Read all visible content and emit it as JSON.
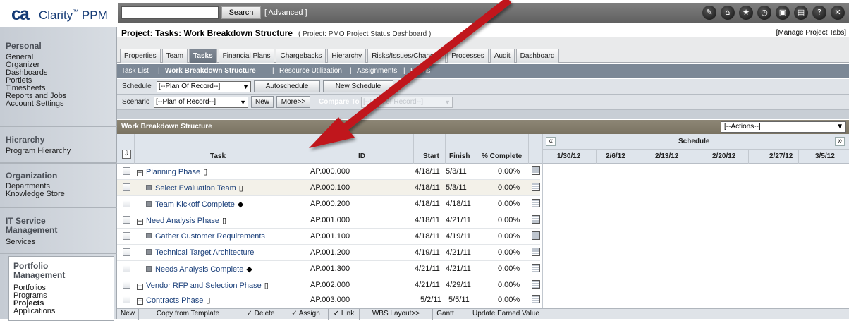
{
  "app": {
    "logo_mark": "ca",
    "product": "Clarity",
    "tm": "™",
    "product_suffix": "PPM"
  },
  "search": {
    "value": "",
    "button": "Search",
    "advanced": "[ Advanced ]"
  },
  "toolbar_icons": [
    "wrench-icon",
    "home-icon",
    "bookmark-icon",
    "clock-icon",
    "window-icon",
    "print-icon",
    "help-icon",
    "close-icon"
  ],
  "sidebar": {
    "personal": {
      "heading": "Personal",
      "items": [
        "General",
        "Organizer",
        "Dashboards",
        "Portlets",
        "Timesheets",
        "Reports and Jobs",
        "Account Settings"
      ]
    },
    "hierarchy": {
      "heading": "Hierarchy",
      "items": [
        "Program Hierarchy"
      ]
    },
    "organization": {
      "heading": "Organization",
      "items": [
        "Departments",
        "Knowledge Store"
      ]
    },
    "it": {
      "heading1": "IT Service",
      "heading2": "Management",
      "items": [
        "Services"
      ]
    },
    "portfolio": {
      "heading1": "Portfolio",
      "heading2": "Management",
      "items": [
        "Portfolios",
        "Programs",
        "Projects",
        "Applications"
      ]
    }
  },
  "header": {
    "title": "Project: Tasks: Work Breakdown Structure",
    "subtitle": "( Project: PMO Project Status Dashboard )",
    "manage_tabs": "[Manage Project Tabs]"
  },
  "tabs": [
    "Properties",
    "Team",
    "Tasks",
    "Financial Plans",
    "Chargebacks",
    "Hierarchy",
    "Risks/Issues/Changes",
    "Processes",
    "Audit",
    "Dashboard"
  ],
  "active_tab": "Tasks",
  "subnav": {
    "items": [
      "Task List",
      "Work Breakdown Structure",
      "Resource Utilization",
      "Assignments",
      "Forms"
    ],
    "separator": "|"
  },
  "schedule_row": {
    "label": "Schedule",
    "select": "[--Plan Of Record--]",
    "autoschedule": "Autoschedule",
    "new_schedule": "New Schedule"
  },
  "scenario_row": {
    "label": "Scenario",
    "select": "[--Plan of Record--]",
    "new": "New",
    "more": "More>>",
    "compare_label": "Compare To",
    "compare_select": "[--Plan of Record--]"
  },
  "wbs": {
    "title": "Work Breakdown Structure",
    "actions": "[--Actions--]"
  },
  "columns": {
    "task": "Task",
    "id": "ID",
    "start": "Start",
    "finish": "Finish",
    "pct": "% Complete",
    "schedule": "Schedule"
  },
  "weeks": [
    "1/30/12",
    "2/6/12",
    "2/13/12",
    "2/20/12",
    "2/27/12",
    "3/5/12"
  ],
  "rows": [
    {
      "task": "Planning Phase",
      "id": "AP.000.000",
      "start": "4/18/11",
      "finish": "5/3/11",
      "pct": "0.00%"
    },
    {
      "task": "Select Evaluation Team",
      "id": "AP.000.100",
      "start": "4/18/11",
      "finish": "5/3/11",
      "pct": "0.00%"
    },
    {
      "task": "Team Kickoff Complete",
      "id": "AP.000.200",
      "start": "4/18/11",
      "finish": "4/18/11",
      "pct": "0.00%"
    },
    {
      "task": "Need Analysis Phase",
      "id": "AP.001.000",
      "start": "4/18/11",
      "finish": "4/21/11",
      "pct": "0.00%"
    },
    {
      "task": "Gather Customer Requirements",
      "id": "AP.001.100",
      "start": "4/18/11",
      "finish": "4/19/11",
      "pct": "0.00%"
    },
    {
      "task": "Technical Target Architecture",
      "id": "AP.001.200",
      "start": "4/19/11",
      "finish": "4/21/11",
      "pct": "0.00%"
    },
    {
      "task": "Needs Analysis Complete",
      "id": "AP.001.300",
      "start": "4/21/11",
      "finish": "4/21/11",
      "pct": "0.00%"
    },
    {
      "task": "Vendor RFP and Selection Phase",
      "id": "AP.002.000",
      "start": "4/21/11",
      "finish": "4/29/11",
      "pct": "0.00%"
    },
    {
      "task": "Contracts Phase",
      "id": "AP.003.000",
      "start": "5/2/11",
      "finish": "5/5/11",
      "pct": "0.00%"
    }
  ],
  "bottom_buttons": [
    "New",
    "Copy from Template",
    "✓ Delete",
    "✓ Assign",
    "✓ Link",
    "WBS Layout>>",
    "Gantt",
    "Update Earned Value"
  ],
  "colors": {
    "navy": "#143a75",
    "tab_active": "#6a7480",
    "subnav": "#7c8896",
    "wbs_header": "#7a7362",
    "arrow": "#c0171b"
  }
}
